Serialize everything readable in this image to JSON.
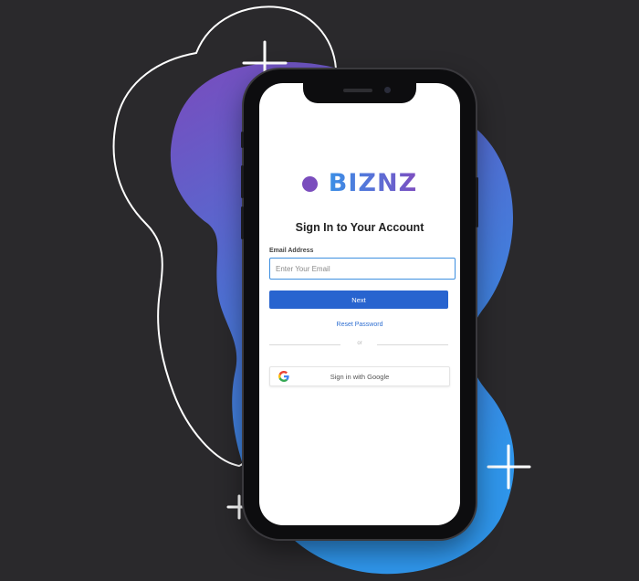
{
  "colors": {
    "background": "#2a292c",
    "blob_gradient_start": "#7a4bbd",
    "blob_gradient_end": "#2f8fe6",
    "primary_button": "#2864cf",
    "link": "#2f6fd1",
    "brand_dot": "#7a4dbd",
    "input_border": "#3d8fe0"
  },
  "decorations": {
    "outline_blob_icon": "outline-blob-icon",
    "gradient_blob_icon": "gradient-blob-icon",
    "plus_icons": [
      "plus-icon",
      "plus-icon",
      "plus-icon"
    ]
  },
  "brand": {
    "name": "BIZNZ",
    "logo_icon": "circle-dot-icon"
  },
  "signin": {
    "title": "Sign In to Your Account",
    "email_label": "Email Address",
    "email_placeholder": "Enter Your Email",
    "email_value": "",
    "next_label": "Next",
    "reset_label": "Reset Password",
    "divider_text": "or",
    "google_label": "Sign in with Google",
    "google_icon": "google-g-icon"
  }
}
